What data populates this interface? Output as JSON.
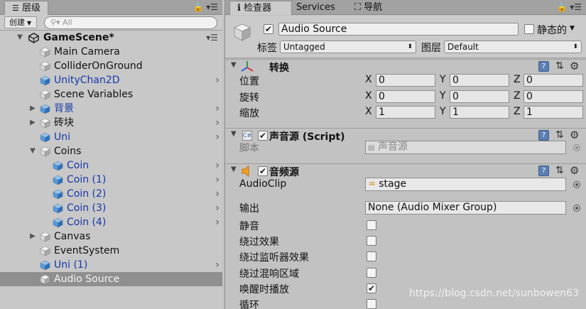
{
  "hierarchy": {
    "tab_label": "层级",
    "create_label": "创建",
    "search_placeholder": "All",
    "scene_name": "GameScene*",
    "items": [
      {
        "label": "Main Camera",
        "style": "normal"
      },
      {
        "label": "ColliderOnGround",
        "style": "normal"
      },
      {
        "label": "UnityChan2D",
        "style": "blue"
      },
      {
        "label": "Scene Variables",
        "style": "normal"
      },
      {
        "label": "背景",
        "style": "blue"
      },
      {
        "label": "砖块",
        "style": "normal"
      },
      {
        "label": "Uni",
        "style": "blue"
      },
      {
        "label": "Coins",
        "style": "normal"
      },
      {
        "label": "Coin",
        "style": "blue"
      },
      {
        "label": "Coin (1)",
        "style": "blue"
      },
      {
        "label": "Coin (2)",
        "style": "blue"
      },
      {
        "label": "Coin (3)",
        "style": "blue"
      },
      {
        "label": "Coin (4)",
        "style": "blue"
      },
      {
        "label": "Canvas",
        "style": "normal"
      },
      {
        "label": "EventSystem",
        "style": "normal"
      },
      {
        "label": "Uni (1)",
        "style": "blue"
      },
      {
        "label": "Audio Source",
        "style": "selected"
      }
    ]
  },
  "inspector": {
    "tabs": [
      "检查器",
      "Services",
      "导航"
    ],
    "object": {
      "name": "Audio Source",
      "active": true,
      "static_label": "静态的",
      "static_checked": false,
      "tag_label": "标签",
      "tag_value": "Untagged",
      "layer_label": "图层",
      "layer_value": "Default"
    },
    "transform": {
      "title": "转换",
      "rows": [
        {
          "label": "位置",
          "x": "0",
          "y": "0",
          "z": "0"
        },
        {
          "label": "旋转",
          "x": "0",
          "y": "0",
          "z": "0"
        },
        {
          "label": "缩放",
          "x": "1",
          "y": "1",
          "z": "1"
        }
      ],
      "axis_x": "X",
      "axis_y": "Y",
      "axis_z": "Z"
    },
    "script_component": {
      "title": "声音源 (Script)",
      "enabled": true,
      "script_label": "脚本",
      "script_value": "声音源"
    },
    "audio_source": {
      "title": "音频源",
      "enabled": true,
      "clip_label": "AudioClip",
      "clip_value": "stage",
      "output_label": "输出",
      "output_value": "None (Audio Mixer Group)",
      "options": [
        {
          "label": "静音",
          "checked": false
        },
        {
          "label": "绕过效果",
          "checked": false
        },
        {
          "label": "绕过监听器效果",
          "checked": false
        },
        {
          "label": "绕过混响区域",
          "checked": false
        },
        {
          "label": "唤醒时播放",
          "checked": true
        },
        {
          "label": "循环",
          "checked": false
        }
      ]
    }
  },
  "watermark": "https://blog.csdn.net/sunbowen63"
}
